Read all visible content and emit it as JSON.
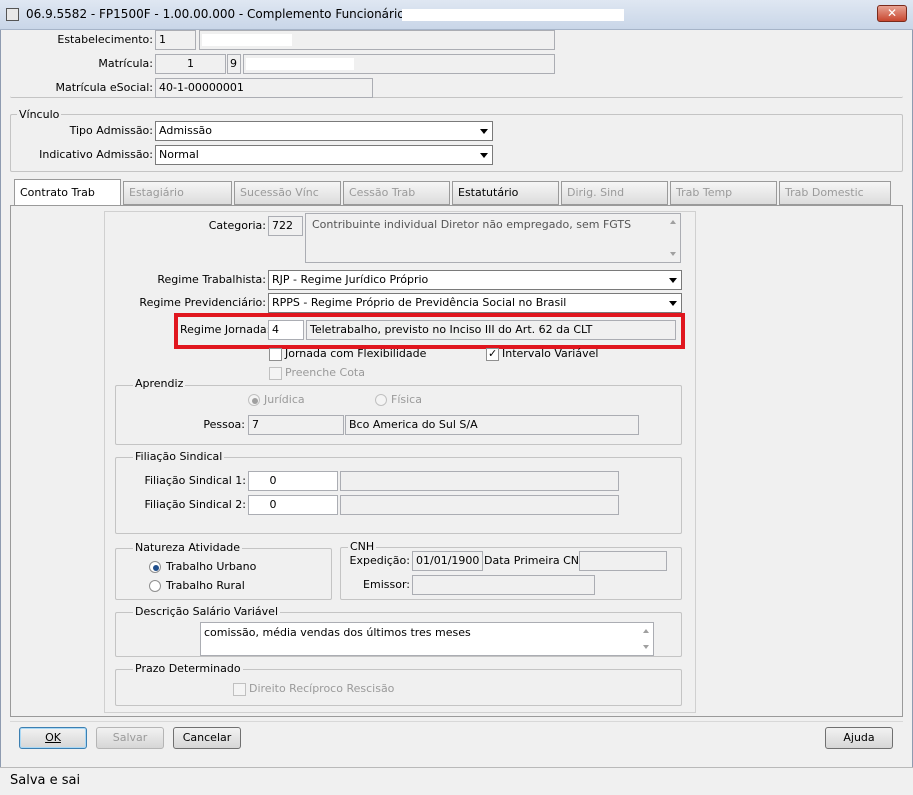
{
  "window": {
    "title": "06.9.5582 - FP1500F - 1.00.00.000 - Complemento Funcionário - 40 - 40-",
    "close_label": "✕"
  },
  "header": {
    "estabelecimento_label": "Estabelecimento:",
    "estabelecimento_code": "1",
    "matricula_label": "Matrícula:",
    "matricula_value": "1",
    "matricula_digit": "9",
    "matricula_esocial_label": "Matrícula eSocial:",
    "matricula_esocial_value": "40-1-00000001"
  },
  "vinculo": {
    "legend": "Vínculo",
    "tipo_admissao_label": "Tipo Admissão:",
    "tipo_admissao_value": "Admissão",
    "indicativo_admissao_label": "Indicativo Admissão:",
    "indicativo_admissao_value": "Normal"
  },
  "tabs": [
    {
      "label": "Contrato Trab"
    },
    {
      "label": "Estagiário"
    },
    {
      "label": "Sucessão Vínc"
    },
    {
      "label": "Cessão Trab"
    },
    {
      "label": "Estatutário"
    },
    {
      "label": "Dirig. Sind"
    },
    {
      "label": "Trab Temp"
    },
    {
      "label": "Trab Domestic"
    }
  ],
  "contrato": {
    "categoria_label": "Categoria:",
    "categoria_code": "722",
    "categoria_desc": "Contribuinte individual  Diretor não empregado, sem FGTS",
    "regime_trabalhista_label": "Regime Trabalhista:",
    "regime_trabalhista_value": "RJP - Regime Jurídico Próprio",
    "regime_previdenciario_label": "Regime Previdenciário:",
    "regime_previdenciario_value": "RPPS - Regime Próprio de Previdência Social no Brasil",
    "regime_jornada_label": "Regime Jornada:",
    "regime_jornada_code": "4",
    "regime_jornada_desc": "Teletrabalho, previsto no Inciso III do Art. 62 da CLT",
    "jornada_flex_label": "Jornada com Flexibilidade",
    "intervalo_variavel_label": "Intervalo Variável",
    "preenche_cota_label": "Preenche Cota",
    "highlight_color": "#e0161e"
  },
  "aprendiz": {
    "legend": "Aprendiz",
    "juridica_label": "Jurídica",
    "fisica_label": "Física",
    "pessoa_label": "Pessoa:",
    "pessoa_code": "7",
    "pessoa_name": "Bco America do Sul S/A"
  },
  "filiacao": {
    "legend": "Filiação Sindical",
    "sindical1_label": "Filiação Sindical 1:",
    "sindical1_value": "0",
    "sindical2_label": "Filiação Sindical 2:",
    "sindical2_value": "0"
  },
  "natureza": {
    "legend": "Natureza Atividade",
    "urbano_label": "Trabalho Urbano",
    "rural_label": "Trabalho Rural"
  },
  "cnh": {
    "legend": "CNH",
    "expedicao_label": "Expedição:",
    "expedicao_value": "01/01/1900",
    "primeira_label": "Data Primeira CNH:",
    "emissor_label": "Emissor:"
  },
  "salario": {
    "legend": "Descrição Salário Variável",
    "value": "comissão, média vendas dos últimos tres meses"
  },
  "prazo": {
    "legend": "Prazo Determinado",
    "direito_label": "Direito Recíproco Rescisão"
  },
  "buttons": {
    "ok": "OK",
    "salvar": "Salvar",
    "cancelar": "Cancelar",
    "ajuda": "Ajuda"
  },
  "status": {
    "text": "Salva e sai"
  }
}
